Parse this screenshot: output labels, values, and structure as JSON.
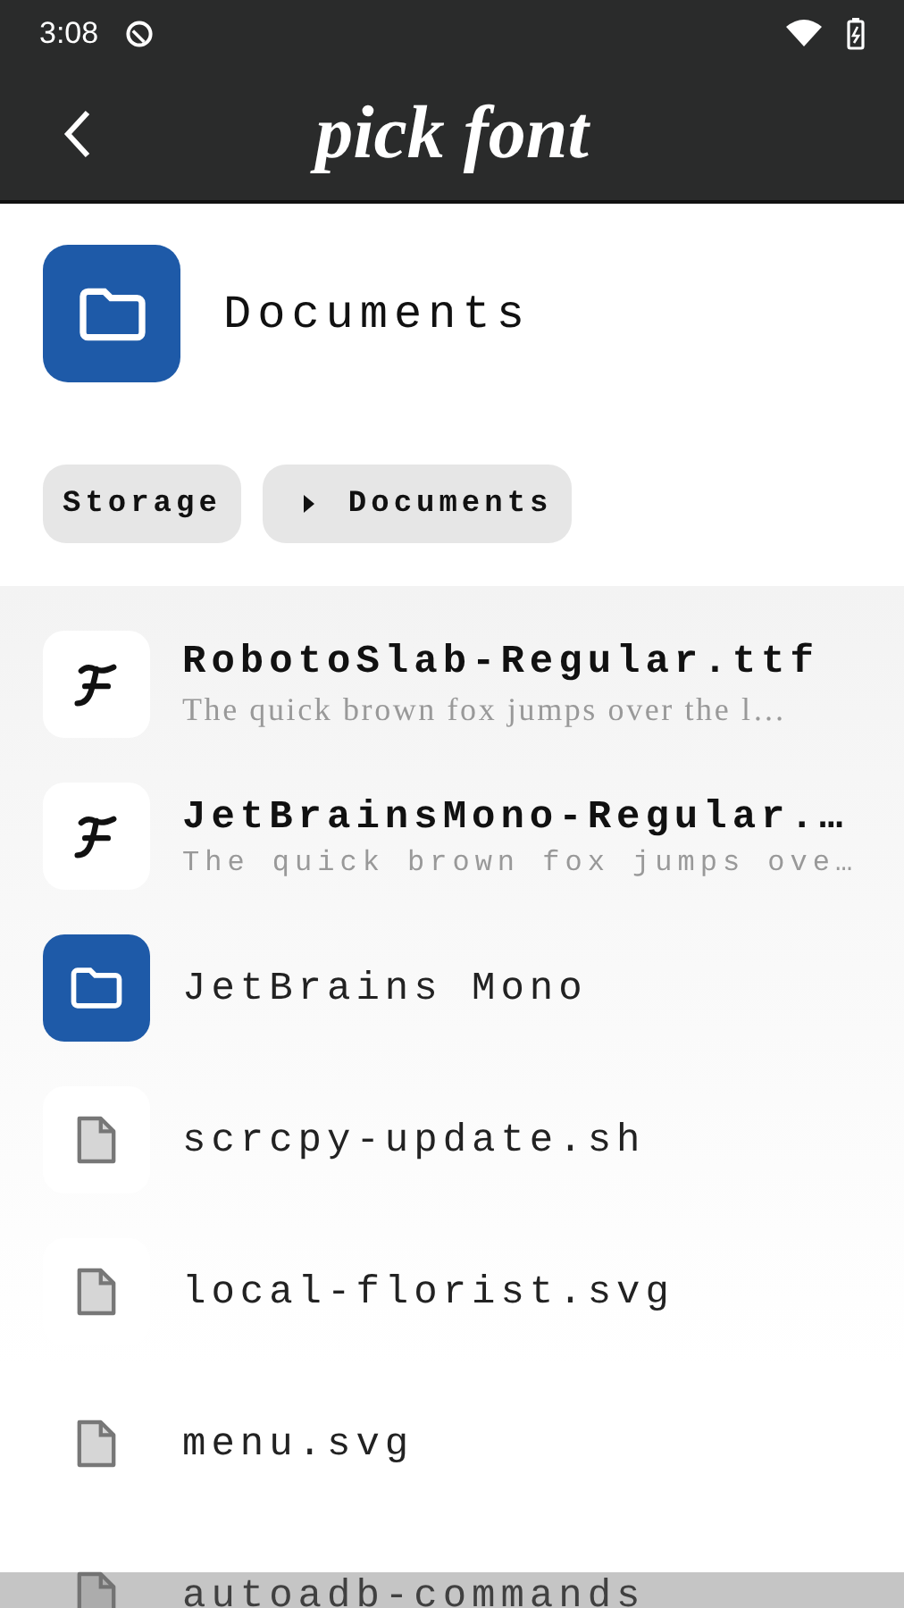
{
  "status_bar": {
    "time": "3:08"
  },
  "app_bar": {
    "title": "pick font"
  },
  "folder": {
    "name": "Documents"
  },
  "breadcrumbs": [
    {
      "label": "Storage",
      "separator": false
    },
    {
      "label": "Documents",
      "separator": true
    }
  ],
  "items": [
    {
      "kind": "font",
      "name": "RobotoSlab-Regular.ttf",
      "preview": "The quick brown fox jumps over the l…",
      "monospace_preview": false
    },
    {
      "kind": "font",
      "name": "JetBrainsMono-Regular.…",
      "preview": "The quick brown fox jumps ove…",
      "monospace_preview": true
    },
    {
      "kind": "folder",
      "name": "JetBrains Mono"
    },
    {
      "kind": "file",
      "name": "scrcpy-update.sh"
    },
    {
      "kind": "file",
      "name": "local-florist.svg"
    },
    {
      "kind": "file",
      "name": "menu.svg"
    },
    {
      "kind": "file",
      "name": "autoadb-commands"
    }
  ]
}
